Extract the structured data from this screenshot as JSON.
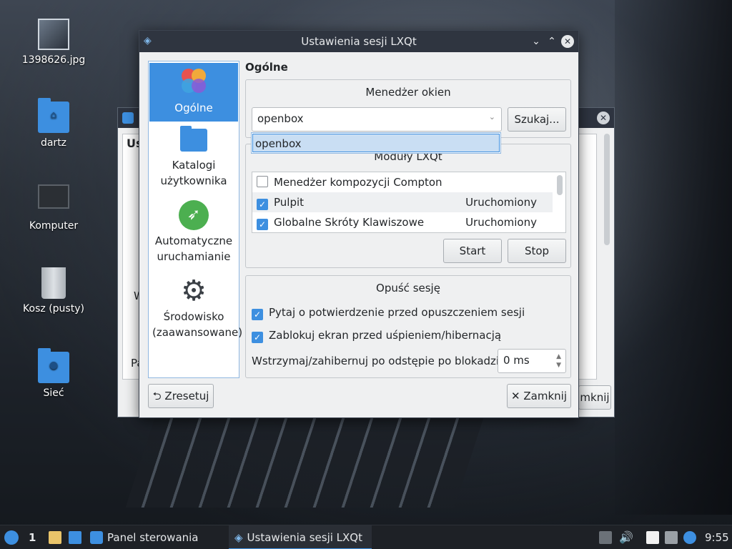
{
  "desktop": {
    "icons": [
      {
        "label": "1398626.jpg",
        "icon": "image-file-icon"
      },
      {
        "label": "dartz",
        "icon": "home-folder-icon"
      },
      {
        "label": "Komputer",
        "icon": "computer-icon"
      },
      {
        "label": "Kosz (pusty)",
        "icon": "trash-icon"
      },
      {
        "label": "Sieć",
        "icon": "network-folder-icon"
      }
    ]
  },
  "background_window": {
    "fragments": [
      "Us",
      "W",
      "Pa",
      "mknij"
    ]
  },
  "dialog": {
    "title": "Ustawienia sesji LXQt",
    "sidebar": [
      {
        "label": "Ogólne",
        "icon": "lxqt-logo-icon",
        "active": true
      },
      {
        "label": "Katalogi użytkownika",
        "icon": "folder-icon"
      },
      {
        "label": "Automatyczne uruchamianie",
        "icon": "rocket-icon"
      },
      {
        "label": "Środowisko (zaawansowane)",
        "icon": "gear-icon"
      }
    ],
    "section_title": "Ogólne",
    "window_manager": {
      "title": "Menedżer okien",
      "value": "openbox",
      "search_label": "Szukaj...",
      "dropdown_options": [
        "openbox"
      ]
    },
    "modules": {
      "title": "Moduły LXQt",
      "rows": [
        {
          "name": "Menedżer kompozycji Compton",
          "checked": false,
          "status": ""
        },
        {
          "name": "Pulpit",
          "checked": true,
          "status": "Uruchomiony"
        },
        {
          "name": "Globalne Skróty Klawiszowe",
          "checked": true,
          "status": "Uruchomiony"
        }
      ],
      "start_label": "Start",
      "stop_label": "Stop"
    },
    "leave_session": {
      "title": "Opuść sesję",
      "ask_confirm": "Pytaj o potwierdzenie przed opuszczeniem sesji",
      "lock_screen": "Zablokuj ekran przed uśpieniem/hibernacją",
      "delay_label": "Wstrzymaj/zahibernuj po odstępie po blokadzie:",
      "delay_value": "0 ms"
    },
    "reset_label": "Zresetuj",
    "close_label": "Zamknij"
  },
  "taskbar": {
    "workspace": "1",
    "tasks": [
      {
        "label": "Panel sterowania",
        "active": false
      },
      {
        "label": "Ustawienia sesji LXQt",
        "active": true
      }
    ],
    "clock": "9:55"
  },
  "colors": {
    "accent": "#3d8fe0",
    "titlebar": "#2f3540",
    "taskbar": "#1e2126"
  }
}
